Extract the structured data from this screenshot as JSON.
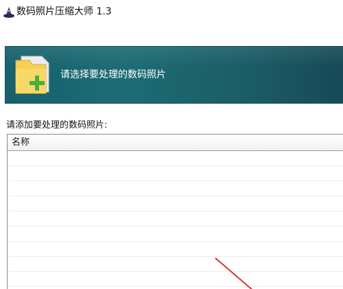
{
  "window": {
    "title": "数码照片压缩大师 1.3"
  },
  "banner": {
    "text": "请选择要处理的数码照片",
    "icon": "folder-add-icon"
  },
  "prompt": {
    "label": "请添加要处理的数码照片:"
  },
  "file_list": {
    "columns": [
      {
        "label": "名称"
      }
    ],
    "rows": []
  },
  "colors": {
    "banner_start": "#17616d",
    "banner_end": "#164a56",
    "arrow": "#e03030",
    "folder": "#f5cf56",
    "plus": "#4caf3a"
  }
}
